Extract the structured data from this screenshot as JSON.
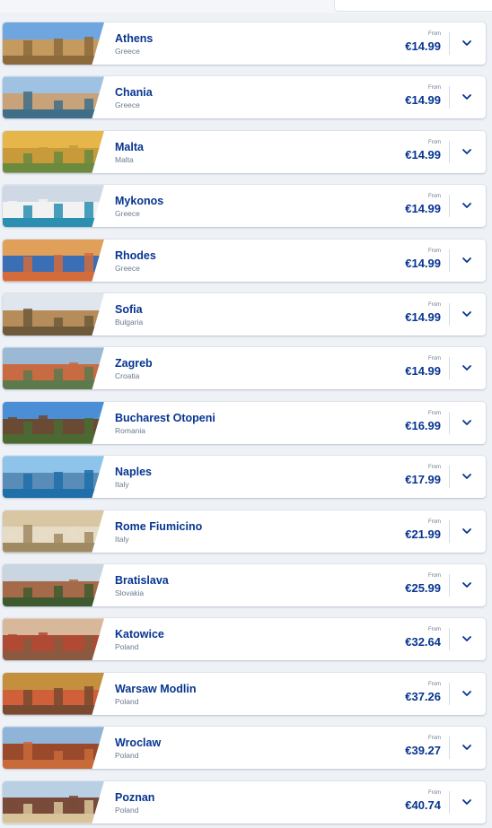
{
  "from_label": "From",
  "colors": {
    "brand_blue": "#073590",
    "muted": "#6b7a90"
  },
  "destinations": [
    {
      "city": "Athens",
      "country": "Greece",
      "price": "€14.99",
      "thumb": [
        "#6fa6e0",
        "#c59a5e",
        "#8d6a3c"
      ]
    },
    {
      "city": "Chania",
      "country": "Greece",
      "price": "€14.99",
      "thumb": [
        "#9fc2e2",
        "#c8a37a",
        "#3f6f88"
      ]
    },
    {
      "city": "Malta",
      "country": "Malta",
      "price": "€14.99",
      "thumb": [
        "#e6b64a",
        "#c89a3a",
        "#6b8a3e"
      ]
    },
    {
      "city": "Mykonos",
      "country": "Greece",
      "price": "€14.99",
      "thumb": [
        "#cfd9e6",
        "#f2f2f2",
        "#2a8fb0"
      ]
    },
    {
      "city": "Rhodes",
      "country": "Greece",
      "price": "€14.99",
      "thumb": [
        "#e0a05a",
        "#3b6fb5",
        "#d46b3a"
      ]
    },
    {
      "city": "Sofia",
      "country": "Bulgaria",
      "price": "€14.99",
      "thumb": [
        "#dfe6ee",
        "#b58c5a",
        "#6e5a3a"
      ]
    },
    {
      "city": "Zagreb",
      "country": "Croatia",
      "price": "€14.99",
      "thumb": [
        "#9bb9d4",
        "#c86a42",
        "#5c7a4c"
      ]
    },
    {
      "city": "Bucharest Otopeni",
      "country": "Romania",
      "price": "€16.99",
      "thumb": [
        "#4a8fd6",
        "#6a4a34",
        "#4a6a32"
      ]
    },
    {
      "city": "Naples",
      "country": "Italy",
      "price": "€17.99",
      "thumb": [
        "#8ec3ea",
        "#5a8cb8",
        "#1f6fa8"
      ]
    },
    {
      "city": "Rome Fiumicino",
      "country": "Italy",
      "price": "€21.99",
      "thumb": [
        "#d9c7a4",
        "#e6dcc6",
        "#a08a62"
      ]
    },
    {
      "city": "Bratislava",
      "country": "Slovakia",
      "price": "€25.99",
      "thumb": [
        "#c9d6e2",
        "#a46a4a",
        "#3f5a2e"
      ]
    },
    {
      "city": "Katowice",
      "country": "Poland",
      "price": "€32.64",
      "thumb": [
        "#d7b89a",
        "#b04a34",
        "#8a5a40"
      ]
    },
    {
      "city": "Warsaw Modlin",
      "country": "Poland",
      "price": "€37.26",
      "thumb": [
        "#c4903e",
        "#d0603a",
        "#7a4a30"
      ]
    },
    {
      "city": "Wroclaw",
      "country": "Poland",
      "price": "€39.27",
      "thumb": [
        "#8fb4d8",
        "#9a4a2c",
        "#c86a3a"
      ]
    },
    {
      "city": "Poznan",
      "country": "Poland",
      "price": "€40.74",
      "thumb": [
        "#b9d0e4",
        "#7a4a3a",
        "#d8c49a"
      ]
    }
  ]
}
